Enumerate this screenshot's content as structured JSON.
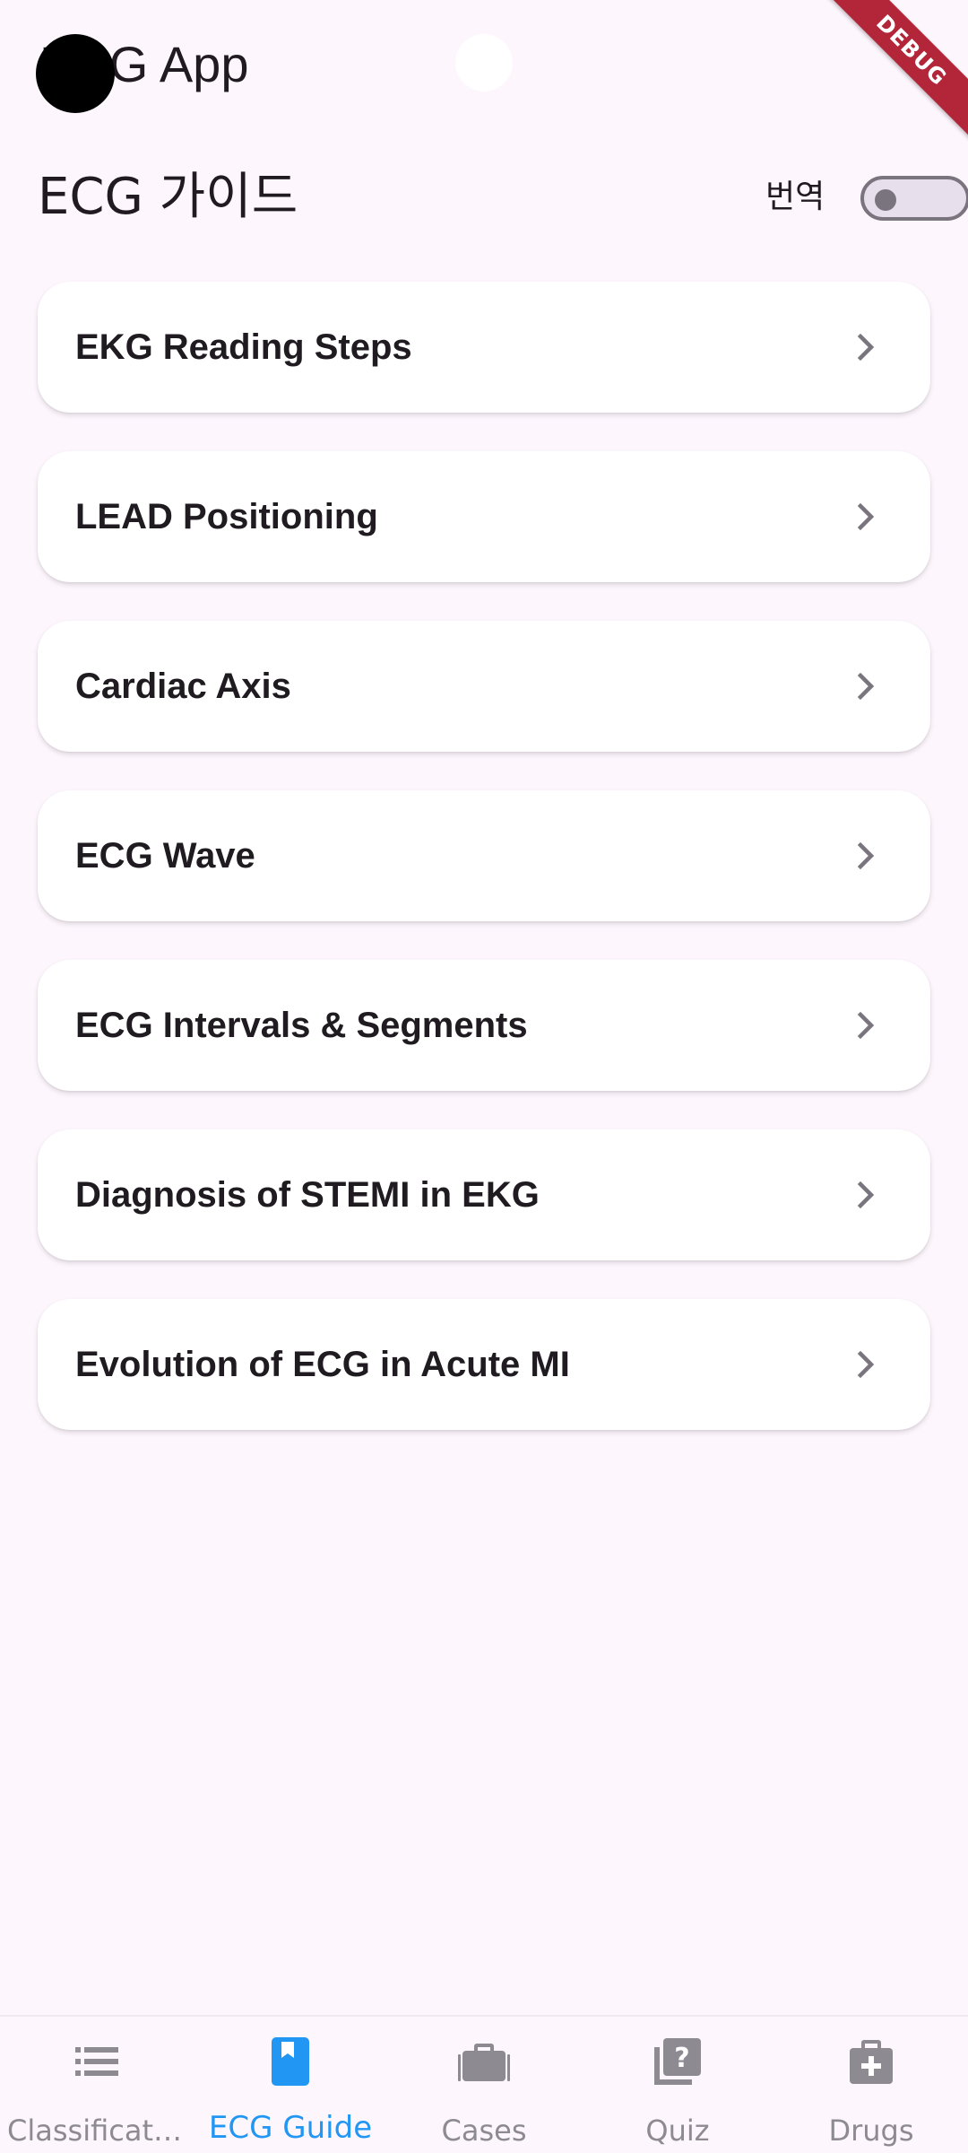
{
  "app_bar": {
    "title": "ECG App",
    "debug_banner": "DEBUG"
  },
  "header": {
    "title": "ECG 가이드",
    "translate_label": "번역",
    "translate_toggle_on": false
  },
  "guide_items": [
    {
      "label": "EKG Reading Steps"
    },
    {
      "label": "LEAD Positioning"
    },
    {
      "label": "Cardiac Axis"
    },
    {
      "label": "ECG Wave"
    },
    {
      "label": "ECG Intervals & Segments"
    },
    {
      "label": "Diagnosis of STEMI in EKG"
    },
    {
      "label": "Evolution of ECG in Acute MI"
    }
  ],
  "bottom_nav": {
    "items": [
      {
        "label": "Classification",
        "icon": "list-icon",
        "active": false
      },
      {
        "label": "ECG Guide",
        "icon": "bookmark-book-icon",
        "active": true
      },
      {
        "label": "Cases",
        "icon": "briefcase-icon",
        "active": false
      },
      {
        "label": "Quiz",
        "icon": "quiz-question-icon",
        "active": false
      },
      {
        "label": "Drugs",
        "icon": "medical-kit-icon",
        "active": false
      }
    ]
  },
  "colors": {
    "background": "#fdf6fd",
    "active_nav": "#2196f3",
    "inactive_nav": "#8d8a92",
    "debug_banner": "#b3263a"
  }
}
